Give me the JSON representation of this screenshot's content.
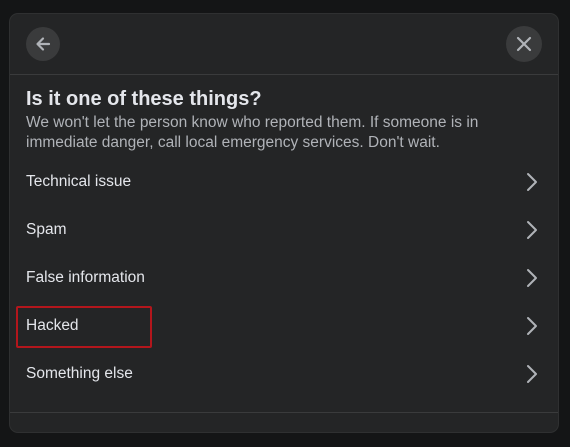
{
  "dialog": {
    "title": "Is it one of these things?",
    "subtitle": "We won't let the person know who reported them. If someone is in immediate danger, call local emergency services. Don't wait.",
    "back_icon": "arrow-left-icon",
    "close_icon": "close-icon",
    "options": [
      {
        "label": "Technical issue",
        "icon": "chevron-right-icon"
      },
      {
        "label": "Spam",
        "icon": "chevron-right-icon"
      },
      {
        "label": "False information",
        "icon": "chevron-right-icon"
      },
      {
        "label": "Hacked",
        "icon": "chevron-right-icon",
        "highlighted": true
      },
      {
        "label": "Something else",
        "icon": "chevron-right-icon"
      }
    ]
  },
  "colors": {
    "dialog_bg": "#242526",
    "text_primary": "#e4e6eb",
    "text_secondary": "#b0b3b8",
    "button_bg": "#3a3b3c",
    "highlight_border": "#b3161c"
  }
}
